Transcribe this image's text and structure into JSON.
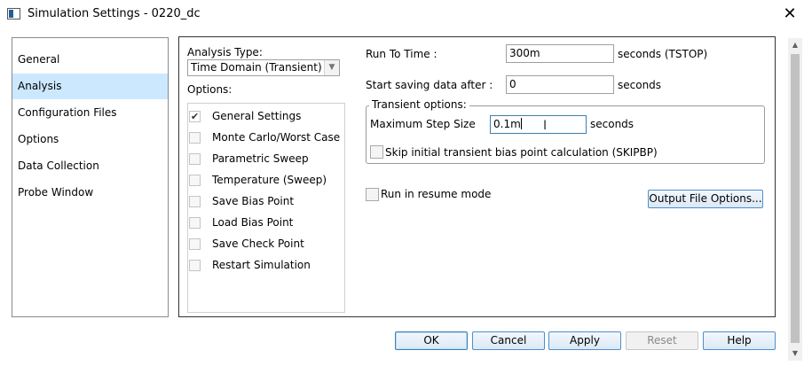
{
  "window": {
    "title": "Simulation Settings - 0220_dc",
    "close_glyph": "✕"
  },
  "sidebar": {
    "items": [
      {
        "label": "General"
      },
      {
        "label": "Analysis",
        "selected": true
      },
      {
        "label": "Configuration Files"
      },
      {
        "label": "Options"
      },
      {
        "label": "Data Collection"
      },
      {
        "label": "Probe Window"
      }
    ]
  },
  "analysis": {
    "type_label": "Analysis Type:",
    "type_value": "Time Domain (Transient)",
    "options_label": "Options:",
    "options": [
      {
        "label": "General Settings",
        "checked": true
      },
      {
        "label": "Monte Carlo/Worst Case",
        "checked": false
      },
      {
        "label": "Parametric Sweep",
        "checked": false
      },
      {
        "label": "Temperature (Sweep)",
        "checked": false
      },
      {
        "label": "Save Bias Point",
        "checked": false
      },
      {
        "label": "Load Bias Point",
        "checked": false
      },
      {
        "label": "Save Check Point",
        "checked": false
      },
      {
        "label": "Restart Simulation",
        "checked": false
      }
    ]
  },
  "settings": {
    "run_to_time_label": "Run To Time :",
    "run_to_time_value": "300m",
    "run_to_time_unit": "seconds (TSTOP)",
    "start_saving_label": "Start saving data after :",
    "start_saving_value": "0",
    "start_saving_unit": "seconds",
    "transient_group_title": "Transient options:",
    "max_step_label": "Maximum Step Size",
    "max_step_value": "0.1m",
    "max_step_unit": "seconds",
    "skip_bias_label": "Skip initial transient bias point calculation (SKIPBP)",
    "skip_bias_checked": false,
    "resume_label": "Run in resume mode",
    "resume_checked": false,
    "output_file_button": "Output File Options..."
  },
  "buttons": {
    "ok": "OK",
    "cancel": "Cancel",
    "apply": "Apply",
    "reset": "Reset",
    "help": "Help"
  },
  "icons": {
    "check": "✔",
    "dropdown_arrow": "▼",
    "scroll_up": "▲",
    "scroll_down": "▼",
    "ibeam": "I"
  },
  "colors": {
    "selection": "#cce8ff",
    "button_border": "#4d8fcc",
    "focus_border": "#3c7fb1"
  }
}
